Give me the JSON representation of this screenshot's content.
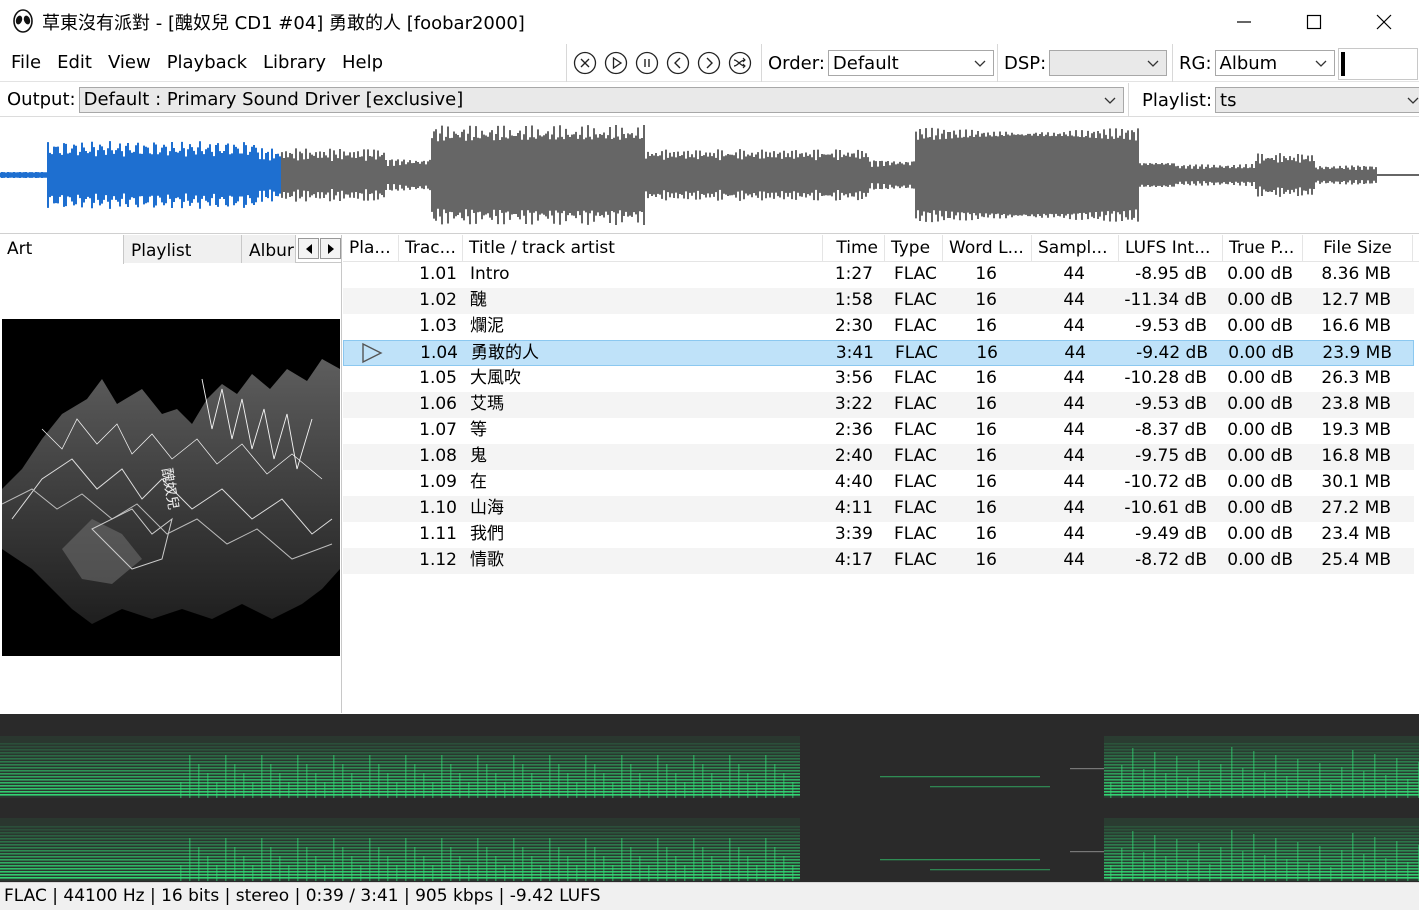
{
  "window": {
    "title": "草東沒有派對 - [醜奴兒 CD1 #04] 勇敢的人  [foobar2000]",
    "minimize_icon": "minimize-icon",
    "maximize_icon": "maximize-icon",
    "close_icon": "close-icon"
  },
  "menu": [
    "File",
    "Edit",
    "View",
    "Playback",
    "Library",
    "Help"
  ],
  "transport": [
    "stop",
    "play",
    "pause",
    "previous",
    "next",
    "random"
  ],
  "order": {
    "label": "Order:",
    "value": "Default"
  },
  "dsp": {
    "label": "DSP:",
    "value": ""
  },
  "rg": {
    "label": "RG:",
    "value": "Album"
  },
  "output": {
    "label": "Output:",
    "value": "Default : Primary Sound Driver [exclusive]"
  },
  "playlist_select": {
    "label": "Playlist:",
    "value": "ts"
  },
  "left_tabs": [
    "Art",
    "Playlist",
    "Albur"
  ],
  "playlist": {
    "columns": [
      "Pla...",
      "Trac...",
      "Title / track artist",
      "Time",
      "Type",
      "Word L...",
      "Sampl...",
      "LUFS Int...",
      "True P...",
      "File Size"
    ],
    "rows": [
      {
        "track": "1.01",
        "title": "Intro",
        "time": "1:27",
        "type": "FLAC",
        "word": "16",
        "sample": "44",
        "lufs": "-8.95 dB",
        "peak": "0.00 dB",
        "size": "8.36 MB"
      },
      {
        "track": "1.02",
        "title": "醜",
        "time": "1:58",
        "type": "FLAC",
        "word": "16",
        "sample": "44",
        "lufs": "-11.34 dB",
        "peak": "0.00 dB",
        "size": "12.7 MB"
      },
      {
        "track": "1.03",
        "title": "爛泥",
        "time": "2:30",
        "type": "FLAC",
        "word": "16",
        "sample": "44",
        "lufs": "-9.53 dB",
        "peak": "0.00 dB",
        "size": "16.6 MB"
      },
      {
        "track": "1.04",
        "title": "勇敢的人",
        "time": "3:41",
        "type": "FLAC",
        "word": "16",
        "sample": "44",
        "lufs": "-9.42 dB",
        "peak": "0.00 dB",
        "size": "23.9 MB",
        "playing": true
      },
      {
        "track": "1.05",
        "title": "大風吹",
        "time": "3:56",
        "type": "FLAC",
        "word": "16",
        "sample": "44",
        "lufs": "-10.28 dB",
        "peak": "0.00 dB",
        "size": "26.3 MB"
      },
      {
        "track": "1.06",
        "title": "艾瑪",
        "time": "3:22",
        "type": "FLAC",
        "word": "16",
        "sample": "44",
        "lufs": "-9.53 dB",
        "peak": "0.00 dB",
        "size": "23.8 MB"
      },
      {
        "track": "1.07",
        "title": "等",
        "time": "2:36",
        "type": "FLAC",
        "word": "16",
        "sample": "44",
        "lufs": "-8.37 dB",
        "peak": "0.00 dB",
        "size": "19.3 MB"
      },
      {
        "track": "1.08",
        "title": "鬼",
        "time": "2:40",
        "type": "FLAC",
        "word": "16",
        "sample": "44",
        "lufs": "-9.75 dB",
        "peak": "0.00 dB",
        "size": "16.8 MB"
      },
      {
        "track": "1.09",
        "title": "在",
        "time": "4:40",
        "type": "FLAC",
        "word": "16",
        "sample": "44",
        "lufs": "-10.72 dB",
        "peak": "0.00 dB",
        "size": "30.1 MB"
      },
      {
        "track": "1.10",
        "title": "山海",
        "time": "4:11",
        "type": "FLAC",
        "word": "16",
        "sample": "44",
        "lufs": "-10.61 dB",
        "peak": "0.00 dB",
        "size": "27.2 MB"
      },
      {
        "track": "1.11",
        "title": "我們",
        "time": "3:39",
        "type": "FLAC",
        "word": "16",
        "sample": "44",
        "lufs": "-9.49 dB",
        "peak": "0.00 dB",
        "size": "23.4 MB"
      },
      {
        "track": "1.12",
        "title": "情歌",
        "time": "4:17",
        "type": "FLAC",
        "word": "16",
        "sample": "44",
        "lufs": "-8.72 dB",
        "peak": "0.00 dB",
        "size": "25.4 MB"
      }
    ]
  },
  "seek": {
    "played_fraction": 0.176
  },
  "status": "FLAC | 44100 Hz | 16 bits | stereo | 0:39 / 3:41 | 905 kbps  | -9.42 LUFS",
  "colors": {
    "accent": "#0078d7",
    "selection": "#bfe2f9",
    "wave_played": "#1e6fd0",
    "wave_rest": "#666666",
    "spectrum": "#33dd77"
  }
}
